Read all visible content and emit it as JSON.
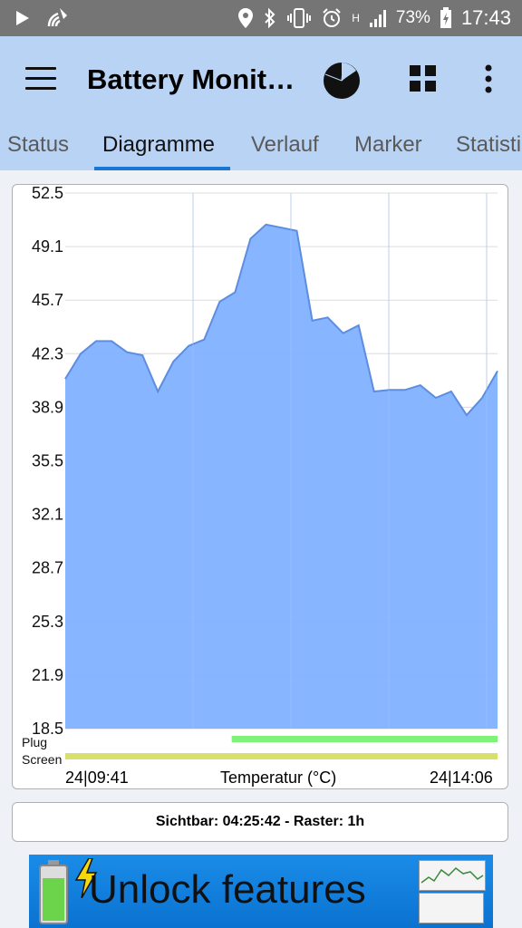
{
  "status_bar": {
    "battery_percent": "73%",
    "time": "17:43",
    "network_type": "H",
    "icons": [
      "play-icon",
      "wifi-call-icon",
      "location-icon",
      "bluetooth-icon",
      "vibrate-icon",
      "alarm-icon",
      "signal-icon",
      "battery-charging-icon"
    ]
  },
  "app_bar": {
    "title": "Battery Monit…",
    "icons": [
      "menu-icon",
      "pie-chart-icon",
      "widgets-icon",
      "more-vert-icon"
    ]
  },
  "tabs": [
    {
      "label": "Status",
      "active": false
    },
    {
      "label": "Diagramme",
      "active": true
    },
    {
      "label": "Verlauf",
      "active": false
    },
    {
      "label": "Marker",
      "active": false
    },
    {
      "label": "Statistik",
      "active": false
    }
  ],
  "chart_data": {
    "type": "area",
    "xlabel": "Temperatur (°C)",
    "x_start": "24|09:41",
    "x_end": "24|14:06",
    "ylim": [
      18.5,
      52.5
    ],
    "y_ticks": [
      "52.5",
      "49.1",
      "45.7",
      "42.3",
      "38.9",
      "35.5",
      "32.1",
      "28.7",
      "25.3",
      "21.9",
      "18.5"
    ],
    "fill_color": "#82b1ff",
    "line_color": "#5c8de0",
    "grid": true,
    "values": [
      40.7,
      42.3,
      43.1,
      43.1,
      42.4,
      42.2,
      39.9,
      41.8,
      42.8,
      43.2,
      45.6,
      46.2,
      49.6,
      50.5,
      50.3,
      50.1,
      44.4,
      44.6,
      43.6,
      44.1,
      39.9,
      40.0,
      40.0,
      40.3,
      39.5,
      39.9,
      38.4,
      39.5,
      41.2
    ],
    "tracks": [
      {
        "label": "Plug",
        "color": "#7ff27a",
        "start_fraction": 0.385,
        "end_fraction": 1.0
      },
      {
        "label": "Screen",
        "color": "#d9df6d",
        "start_fraction": 0.0,
        "end_fraction": 1.0
      }
    ]
  },
  "info": {
    "text": "Sichtbar: 04:25:42 - Raster: 1h"
  },
  "banner": {
    "text": "Unlock features"
  }
}
